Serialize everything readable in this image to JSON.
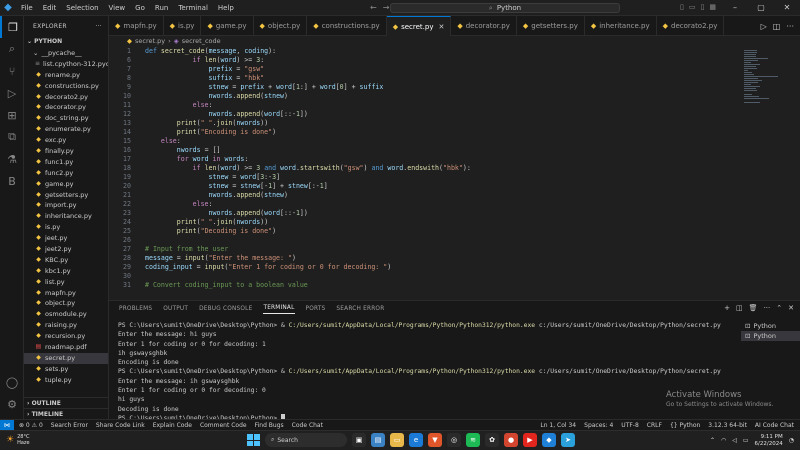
{
  "titlebar": {
    "menu": [
      "File",
      "Edit",
      "Selection",
      "View",
      "Go",
      "Run",
      "Terminal",
      "Help"
    ],
    "search_text": "Python"
  },
  "sidebar": {
    "header": "EXPLORER",
    "section": "PYTHON",
    "folder": "__pycache__",
    "files": [
      {
        "name": "list.cpython-312.pyc",
        "type": "pyc"
      },
      {
        "name": "rename.py",
        "type": "py"
      },
      {
        "name": "constructions.py",
        "type": "py"
      },
      {
        "name": "decorato2.py",
        "type": "py"
      },
      {
        "name": "decorator.py",
        "type": "py"
      },
      {
        "name": "doc_string.py",
        "type": "py"
      },
      {
        "name": "enumerate.py",
        "type": "py"
      },
      {
        "name": "exc.py",
        "type": "py"
      },
      {
        "name": "finally.py",
        "type": "py"
      },
      {
        "name": "func1.py",
        "type": "py"
      },
      {
        "name": "func2.py",
        "type": "py"
      },
      {
        "name": "game.py",
        "type": "py"
      },
      {
        "name": "getsetters.py",
        "type": "py"
      },
      {
        "name": "import.py",
        "type": "py"
      },
      {
        "name": "inheritance.py",
        "type": "py"
      },
      {
        "name": "is.py",
        "type": "py"
      },
      {
        "name": "jeet.py",
        "type": "py"
      },
      {
        "name": "jeet2.py",
        "type": "py"
      },
      {
        "name": "KBC.py",
        "type": "py"
      },
      {
        "name": "kbc1.py",
        "type": "py"
      },
      {
        "name": "list.py",
        "type": "py"
      },
      {
        "name": "mapfn.py",
        "type": "py"
      },
      {
        "name": "object.py",
        "type": "py"
      },
      {
        "name": "osmodule.py",
        "type": "py"
      },
      {
        "name": "raising.py",
        "type": "py"
      },
      {
        "name": "recursion.py",
        "type": "py"
      },
      {
        "name": "roadmap.pdf",
        "type": "pdf"
      },
      {
        "name": "secret.py",
        "type": "py",
        "selected": true
      },
      {
        "name": "sets.py",
        "type": "py"
      },
      {
        "name": "tuple.py",
        "type": "py"
      }
    ],
    "outline": "OUTLINE",
    "timeline": "TIMELINE"
  },
  "tabs": [
    {
      "name": "mapfn.py"
    },
    {
      "name": "is.py"
    },
    {
      "name": "game.py"
    },
    {
      "name": "object.py"
    },
    {
      "name": "constructions.py"
    },
    {
      "name": "secret.py",
      "active": true
    },
    {
      "name": "decorator.py"
    },
    {
      "name": "getsetters.py"
    },
    {
      "name": "inheritance.py"
    },
    {
      "name": "decorato2.py"
    }
  ],
  "breadcrumb": [
    "secret.py",
    "secret_code"
  ],
  "code_lines": [
    {
      "n": "1",
      "html": "<span class='kw'>def</span> <span class='fn'>secret_code</span>(<span class='var'>message</span>, <span class='var'>coding</span>):"
    },
    {
      "n": "6",
      "html": "            <span class='kw2'>if</span> <span class='fn'>len</span>(<span class='var'>word</span>) &gt;= <span class='num'>3</span>:"
    },
    {
      "n": "7",
      "html": "                <span class='var'>prefix</span> = <span class='str'>\"gsw\"</span>"
    },
    {
      "n": "8",
      "html": "                <span class='var'>suffix</span> = <span class='str'>\"hbk\"</span>"
    },
    {
      "n": "9",
      "html": "                <span class='var'>stnew</span> = <span class='var'>prefix</span> + <span class='var'>word</span>[<span class='num'>1</span>:] + <span class='var'>word</span>[<span class='num'>0</span>] + <span class='var'>suffix</span>"
    },
    {
      "n": "10",
      "html": "                <span class='var'>nwords</span>.<span class='fn'>append</span>(<span class='var'>stnew</span>)"
    },
    {
      "n": "11",
      "html": "            <span class='kw2'>else</span>:"
    },
    {
      "n": "12",
      "html": "                <span class='var'>nwords</span>.<span class='fn'>append</span>(<span class='var'>word</span>[::-<span class='num'>1</span>])"
    },
    {
      "n": "13",
      "html": "        <span class='fn'>print</span>(<span class='str'>\" \"</span>.<span class='fn'>join</span>(<span class='var'>nwords</span>))"
    },
    {
      "n": "14",
      "html": "        <span class='fn'>print</span>(<span class='str'>\"Encoding is done\"</span>)"
    },
    {
      "n": "15",
      "html": "    <span class='kw2'>else</span>:"
    },
    {
      "n": "16",
      "html": "        <span class='var'>nwords</span> = []"
    },
    {
      "n": "17",
      "html": "        <span class='kw2'>for</span> <span class='var'>word</span> <span class='kw2'>in</span> <span class='var'>words</span>:"
    },
    {
      "n": "18",
      "html": "            <span class='kw2'>if</span> <span class='fn'>len</span>(<span class='var'>word</span>) &gt;= <span class='num'>3</span> <span class='kw'>and</span> <span class='var'>word</span>.<span class='fn'>startswith</span>(<span class='str'>\"gsw\"</span>) <span class='kw'>and</span> <span class='var'>word</span>.<span class='fn'>endswith</span>(<span class='str'>\"hbk\"</span>):"
    },
    {
      "n": "19",
      "html": "                <span class='var'>stnew</span> = <span class='var'>word</span>[<span class='num'>3</span>:-<span class='num'>3</span>]"
    },
    {
      "n": "20",
      "html": "                <span class='var'>stnew</span> = <span class='var'>stnew</span>[-<span class='num'>1</span>] + <span class='var'>stnew</span>[:-<span class='num'>1</span>]"
    },
    {
      "n": "21",
      "html": "                <span class='var'>nwords</span>.<span class='fn'>append</span>(<span class='var'>stnew</span>)"
    },
    {
      "n": "22",
      "html": "            <span class='kw2'>else</span>:"
    },
    {
      "n": "23",
      "html": "                <span class='var'>nwords</span>.<span class='fn'>append</span>(<span class='var'>word</span>[::-<span class='num'>1</span>])"
    },
    {
      "n": "24",
      "html": "        <span class='fn'>print</span>(<span class='str'>\" \"</span>.<span class='fn'>join</span>(<span class='var'>nwords</span>))"
    },
    {
      "n": "25",
      "html": "        <span class='fn'>print</span>(<span class='str'>\"Decoding is done\"</span>)"
    },
    {
      "n": "26",
      "html": ""
    },
    {
      "n": "27",
      "html": "<span class='cm'># Input from the user</span>"
    },
    {
      "n": "28",
      "html": "<span class='var'>message</span> = <span class='fn'>input</span>(<span class='str'>\"Enter the message: \"</span>)"
    },
    {
      "n": "29",
      "html": "<span class='var'>coding_input</span> = <span class='fn'>input</span>(<span class='str'>\"Enter 1 for coding or 0 for decoding: \"</span>)"
    },
    {
      "n": "30",
      "html": ""
    },
    {
      "n": "31",
      "html": "<span class='cm'># Convert coding_input to a boolean value</span>"
    }
  ],
  "panel": {
    "tabs": [
      "PROBLEMS",
      "OUTPUT",
      "DEBUG CONSOLE",
      "TERMINAL",
      "PORTS",
      "SEARCH ERROR"
    ],
    "active_tab": "TERMINAL",
    "terminal_lines": [
      {
        "prompt": "PS C:\\Users\\sumit\\OneDrive\\Desktop\\Python> & ",
        "path": "C:/Users/sumit/AppData/Local/Programs/Python/Python312/python.exe",
        "rest": " c:/Users/sumit/OneDrive/Desktop/Python/secret.py"
      },
      {
        "text": "Enter the message: hi guys"
      },
      {
        "text": "Enter 1 for coding or 0 for decoding: 1"
      },
      {
        "text": "ih gswaysghbk"
      },
      {
        "text": "Encoding is done"
      },
      {
        "prompt": "PS C:\\Users\\sumit\\OneDrive\\Desktop\\Python> & ",
        "path": "C:/Users/sumit/AppData/Local/Programs/Python/Python312/python.exe",
        "rest": " c:/Users/sumit/OneDrive/Desktop/Python/secret.py"
      },
      {
        "text": "Enter the message: ih gswaysghbk"
      },
      {
        "text": "Enter 1 for coding or 0 for decoding: 0"
      },
      {
        "text": "hi guys"
      },
      {
        "text": "Decoding is done"
      },
      {
        "text": "PS C:\\Users\\sumit\\OneDrive\\Desktop\\Python> "
      }
    ],
    "terminals": [
      "Python",
      "Python"
    ],
    "activate_title": "Activate Windows",
    "activate_sub": "Go to Settings to activate Windows."
  },
  "statusbar": {
    "left": [
      "⊗ 0 ⚠ 0",
      "Search Error",
      "Share Code Link",
      "Explain Code",
      "Comment Code",
      "Find Bugs",
      "Code Chat"
    ],
    "right": [
      "Ln 1, Col 34",
      "Spaces: 4",
      "UTF-8",
      "CRLF",
      "{} Python",
      "3.12.3 64-bit",
      "AI Code Chat"
    ]
  },
  "taskbar": {
    "weather_temp": "28°C",
    "weather_desc": "Haze",
    "search": "Search",
    "time": "9:11 PM",
    "date": "6/22/2024"
  }
}
